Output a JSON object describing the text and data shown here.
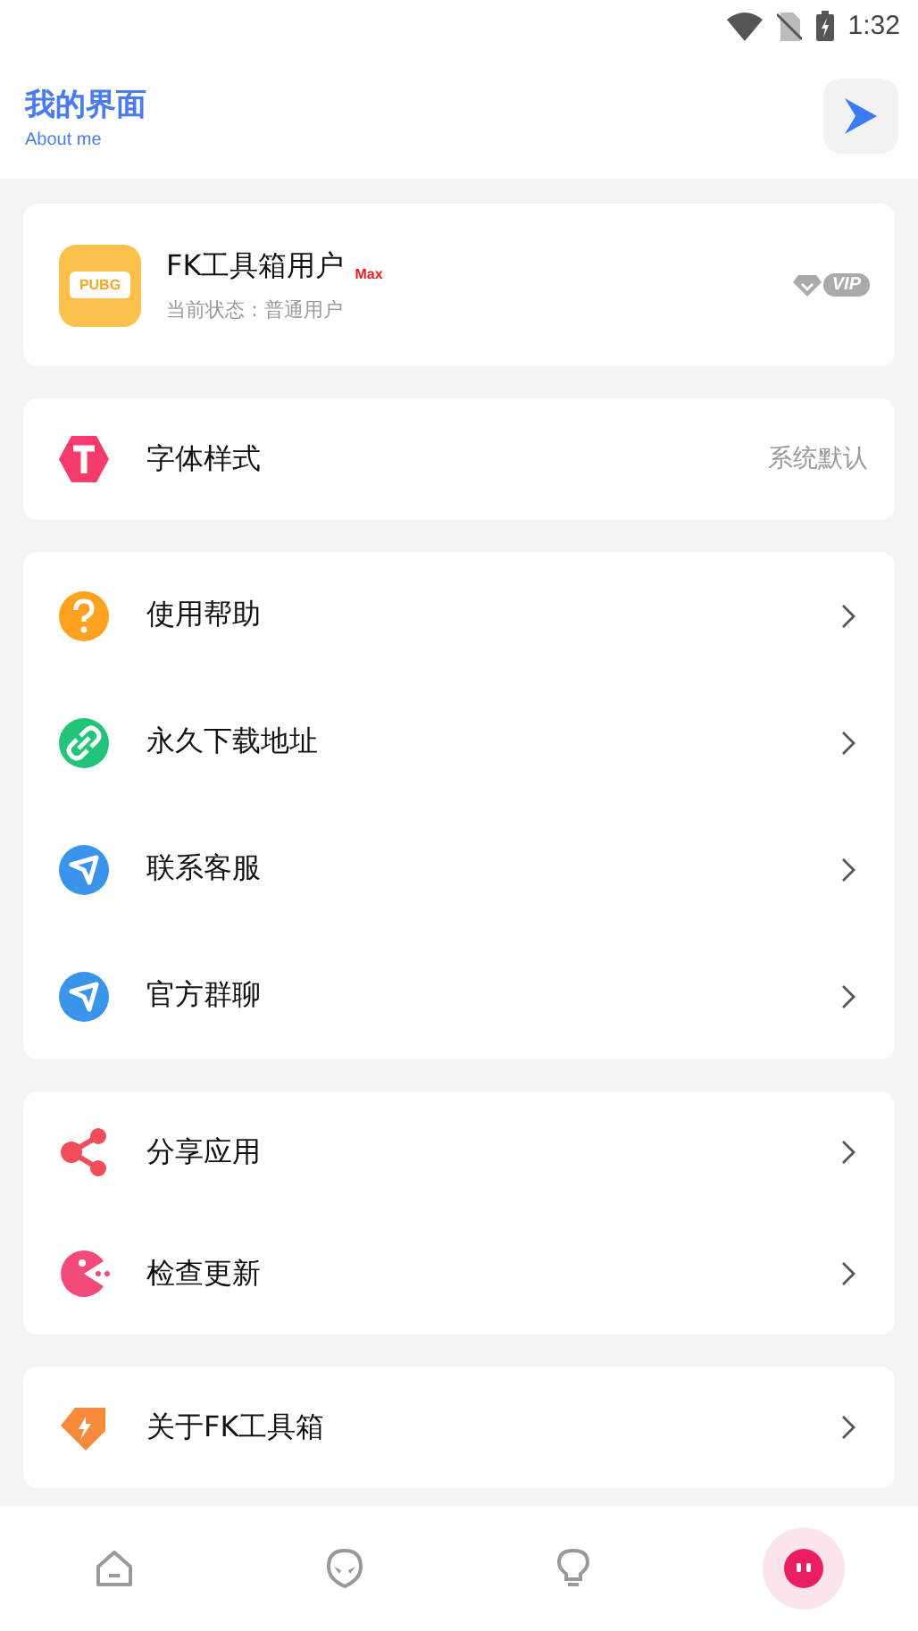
{
  "status_bar": {
    "time": "1:32"
  },
  "header": {
    "title": "我的界面",
    "subtitle": "About me"
  },
  "profile": {
    "avatar_text": "PUBG",
    "name": "FK工具箱用户",
    "tier": "Max",
    "status": "当前状态：普通用户",
    "badge": "VIP"
  },
  "groups": [
    {
      "items": [
        {
          "kind": "font",
          "label": "字体样式",
          "value": "系统默认"
        }
      ]
    },
    {
      "items": [
        {
          "kind": "help",
          "label": "使用帮助"
        },
        {
          "kind": "link",
          "label": "永久下载地址"
        },
        {
          "kind": "send",
          "label": "联系客服"
        },
        {
          "kind": "send",
          "label": "官方群聊"
        }
      ]
    },
    {
      "items": [
        {
          "kind": "share",
          "label": "分享应用"
        },
        {
          "kind": "pacman",
          "label": "检查更新"
        }
      ]
    },
    {
      "items": [
        {
          "kind": "tag",
          "label": "关于FK工具箱"
        }
      ]
    }
  ],
  "bottom_nav": [
    {
      "kind": "home",
      "selected": false
    },
    {
      "kind": "alien",
      "selected": false
    },
    {
      "kind": "bulb",
      "selected": false
    },
    {
      "kind": "face",
      "selected": true
    }
  ]
}
